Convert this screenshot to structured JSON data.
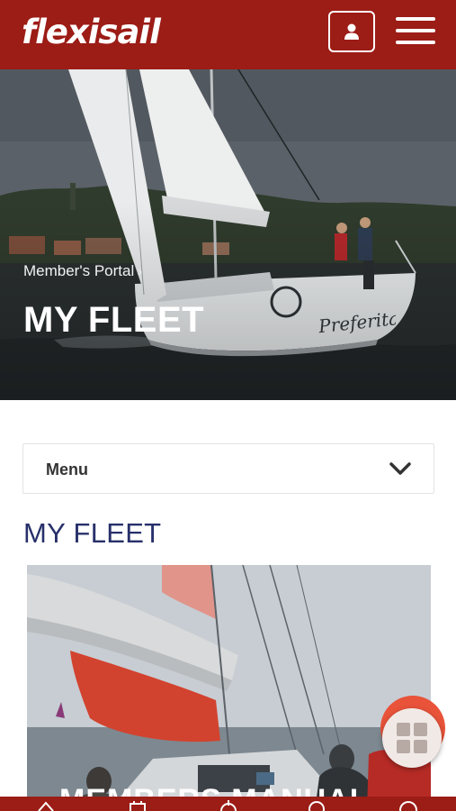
{
  "header": {
    "logo_text": "flexisail",
    "profile_icon": "user-icon",
    "menu_icon": "hamburger-icon"
  },
  "hero": {
    "breadcrumb": "Member's Portal",
    "breadcrumb_chevron": "›",
    "title": "MY FLEET",
    "boat_name": "Preferita"
  },
  "menu": {
    "label": "Menu",
    "icon": "chevron-down-icon"
  },
  "section": {
    "title": "MY FLEET"
  },
  "card": {
    "title": "MEMBERS MANUAL"
  },
  "fab": {
    "icon": "grid-icon"
  },
  "bottom_nav": {
    "icons": [
      "home-icon",
      "calendar-icon",
      "wheel-icon",
      "location-icon",
      "info-icon"
    ]
  },
  "colors": {
    "brand": "#9c1c16",
    "heading": "#27306a",
    "fab_accent": "#e8533a"
  }
}
